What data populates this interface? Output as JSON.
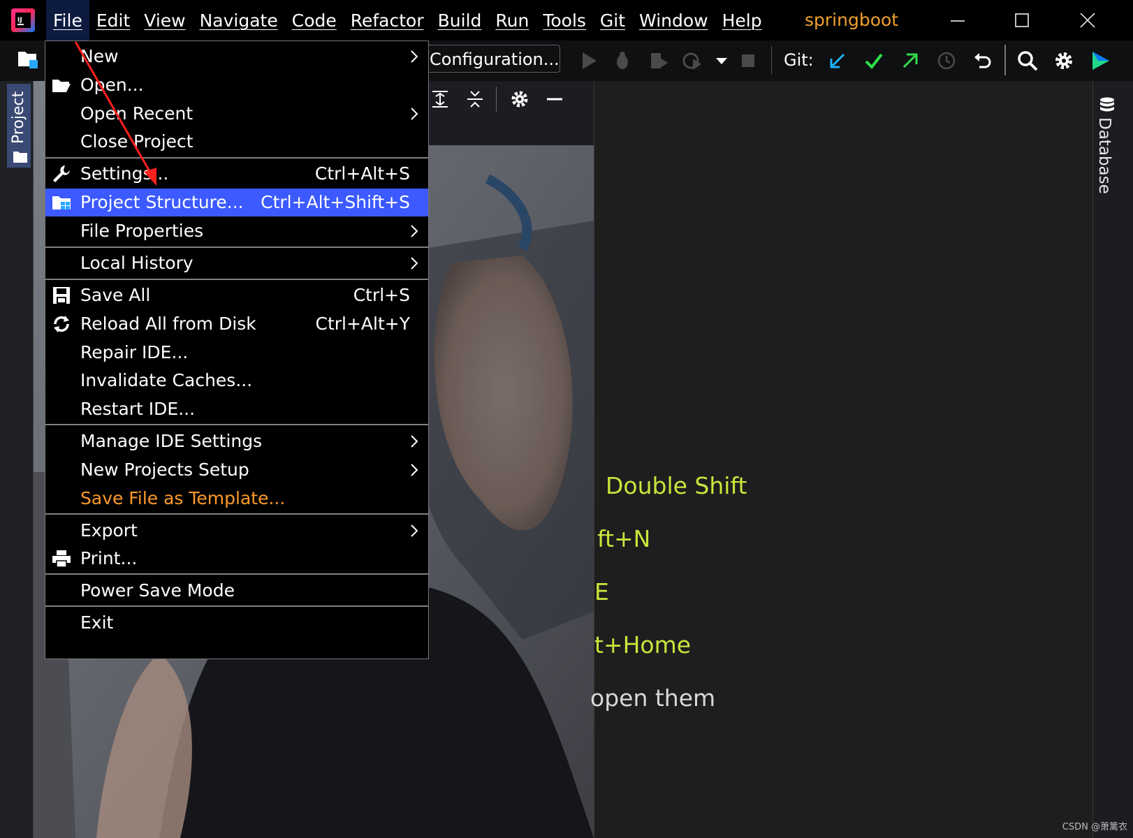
{
  "window": {
    "project_name": "springboot",
    "menus": [
      "File",
      "Edit",
      "View",
      "Navigate",
      "Code",
      "Refactor",
      "Build",
      "Run",
      "Tools",
      "Git",
      "Window",
      "Help"
    ],
    "active_menu": "File"
  },
  "toolbar": {
    "run_config": "Configuration...",
    "git_label": "Git:"
  },
  "left_panel": {
    "project_tab": "Project"
  },
  "right_panel": {
    "database_tab": "Database"
  },
  "file_menu": {
    "items": [
      {
        "label": "New",
        "shortcut": "",
        "submenu": true,
        "icon": ""
      },
      {
        "label": "Open...",
        "shortcut": "",
        "submenu": false,
        "icon": "folder-open-icon"
      },
      {
        "label": "Open Recent",
        "shortcut": "",
        "submenu": true,
        "icon": ""
      },
      {
        "label": "Close Project",
        "shortcut": "",
        "submenu": false,
        "icon": ""
      },
      {
        "label": "Settings...",
        "shortcut": "Ctrl+Alt+S",
        "submenu": false,
        "icon": "wrench-icon"
      },
      {
        "label": "Project Structure...",
        "shortcut": "Ctrl+Alt+Shift+S",
        "submenu": false,
        "icon": "project-structure-icon",
        "highlighted": true
      },
      {
        "label": "File Properties",
        "shortcut": "",
        "submenu": true,
        "icon": ""
      },
      {
        "label": "Local History",
        "shortcut": "",
        "submenu": true,
        "icon": ""
      },
      {
        "label": "Save All",
        "shortcut": "Ctrl+S",
        "submenu": false,
        "icon": "save-icon"
      },
      {
        "label": "Reload All from Disk",
        "shortcut": "Ctrl+Alt+Y",
        "submenu": false,
        "icon": "reload-icon"
      },
      {
        "label": "Repair IDE...",
        "shortcut": "",
        "submenu": false,
        "icon": ""
      },
      {
        "label": "Invalidate Caches...",
        "shortcut": "",
        "submenu": false,
        "icon": ""
      },
      {
        "label": "Restart IDE...",
        "shortcut": "",
        "submenu": false,
        "icon": ""
      },
      {
        "label": "Manage IDE Settings",
        "shortcut": "",
        "submenu": true,
        "icon": ""
      },
      {
        "label": "New Projects Setup",
        "shortcut": "",
        "submenu": true,
        "icon": ""
      },
      {
        "label": "Save File as Template...",
        "shortcut": "",
        "submenu": false,
        "icon": "",
        "color": "#ff9a2a"
      },
      {
        "label": "Export",
        "shortcut": "",
        "submenu": true,
        "icon": ""
      },
      {
        "label": "Print...",
        "shortcut": "",
        "submenu": false,
        "icon": "printer-icon"
      },
      {
        "label": "Power Save Mode",
        "shortcut": "",
        "submenu": false,
        "icon": ""
      },
      {
        "label": "Exit",
        "shortcut": "",
        "submenu": false,
        "icon": ""
      }
    ]
  },
  "editor_hints": [
    {
      "text": "Double Shift",
      "color": "#c8e63c"
    },
    {
      "text": "ft+N",
      "color": "#c8e63c"
    },
    {
      "text": "E",
      "color": "#c8e63c"
    },
    {
      "text": "t+Home",
      "color": "#c8e63c"
    },
    {
      "text": "open them",
      "color": "#d8d8d8"
    }
  ],
  "watermark": "CSDN @萧篱衣",
  "colors": {
    "menu_highlight": "#3c5aff",
    "project_name": "#f0a030",
    "hint_text": "#c8e63c"
  }
}
